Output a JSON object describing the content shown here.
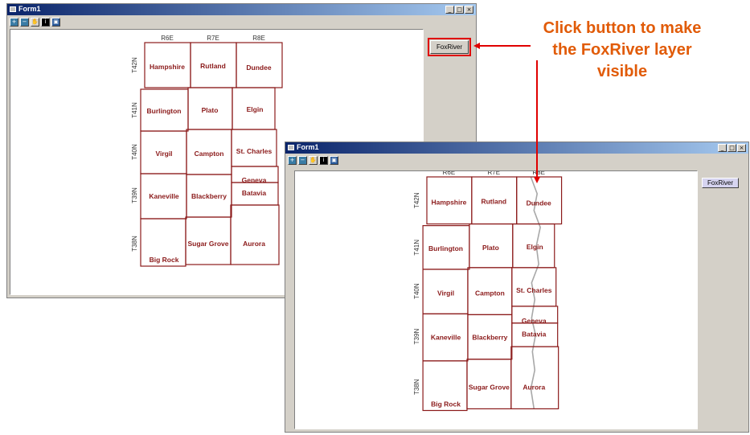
{
  "colors": {
    "titlebar": "#0a246a",
    "map_outline": "#8b1a1a",
    "callout": "#e15b08",
    "arrow": "#e00000",
    "river": "#a8a8a8"
  },
  "window_before": {
    "title": "Form1",
    "window_controls": [
      "_",
      "□",
      "×"
    ],
    "toolbar_icons": [
      "zoom-in-icon",
      "zoom-out-icon",
      "pan-hand-icon",
      "identify-icon",
      "full-extent-icon"
    ],
    "foxriver_button": "FoxRiver",
    "foxriver_layer_visible": false
  },
  "window_after": {
    "title": "Form1",
    "window_controls": [
      "_",
      "□",
      "×"
    ],
    "toolbar_icons": [
      "zoom-in-icon",
      "zoom-out-icon",
      "pan-hand-icon",
      "identify-icon",
      "full-extent-icon"
    ],
    "foxriver_button": "FoxRiver",
    "foxriver_layer_visible": true
  },
  "map": {
    "range_labels": [
      "R6E",
      "R7E",
      "R8E"
    ],
    "township_labels": [
      "T42N",
      "T41N",
      "T40N",
      "T39N",
      "T38N"
    ],
    "townships": [
      "Hampshire",
      "Rutland",
      "Dundee",
      "Burlington",
      "Plato",
      "Elgin",
      "Virgil",
      "Campton",
      "St. Charles",
      "Geneva",
      "Kaneville",
      "Blackberry",
      "Batavia",
      "Big Rock",
      "Sugar Grove",
      "Aurora"
    ]
  },
  "callout": {
    "lines": [
      "Click button to make",
      "the FoxRiver layer",
      "visible"
    ]
  }
}
